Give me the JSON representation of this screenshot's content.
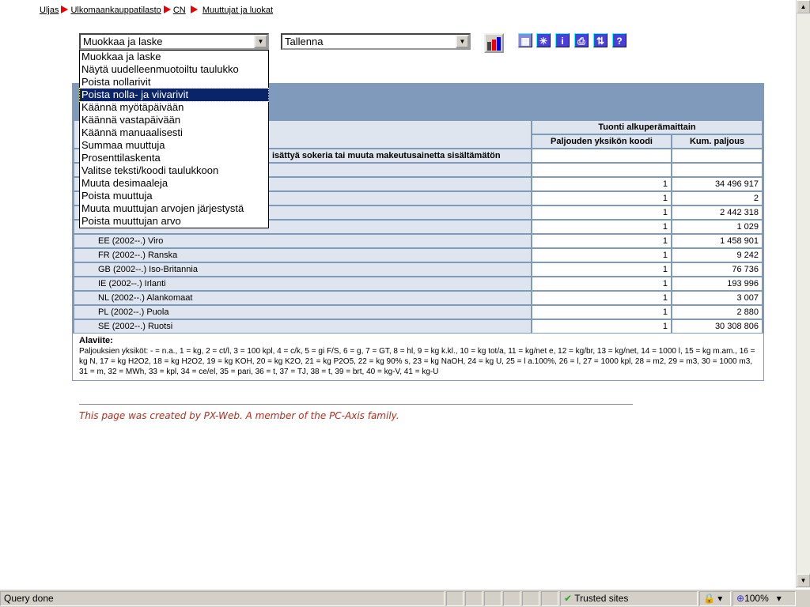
{
  "breadcrumb": [
    "Uljas",
    "Ulkomaankauppatilasto",
    "CN",
    "Muuttujat ja luokat"
  ],
  "toolbar": {
    "action_select": "Muokkaa ja laske",
    "save_select": "Tallenna",
    "options": [
      "Muokkaa ja laske",
      "Näytä uudelleenmuotoiltu taulukko",
      "Poista nollarivit",
      "Poista nolla- ja viivarivit",
      "Käännä myötäpäivään",
      "Käännä vastapäivään",
      "Käännä manuaalisesti",
      "Summaa muuttuja",
      "Prosenttilaskenta",
      "Valitse teksti/koodi taulukkoon",
      "Muuta desimaaleja",
      "Poista muuttuja",
      "Muuta muuttujan arvojen järjestystä",
      "Poista muuttujan arvo"
    ],
    "highlighted": "Poista nolla- ja viivarivit",
    "icons": [
      "chart-icon",
      "table-icon",
      "asterisk-icon",
      "info-icon",
      "print-icon",
      "sort-icon",
      "help-icon"
    ]
  },
  "table": {
    "group_header": "Tuonti alkuperämaittain",
    "columns": [
      "Paljouden yksikön koodi",
      "Kum. paljous"
    ],
    "product_row": "isättyä sokeria tai muuta makeutusainetta sisältämätön",
    "rows": [
      {
        "label": "",
        "code": "1",
        "value": "34 496 917"
      },
      {
        "label": "",
        "code": "1",
        "value": "2"
      },
      {
        "label": "",
        "code": "1",
        "value": "2 442 318"
      },
      {
        "label": "",
        "code": "1",
        "value": "1 029"
      },
      {
        "label": "EE (2002--.) Viro",
        "code": "1",
        "value": "1 458 901"
      },
      {
        "label": "FR (2002--.) Ranska",
        "code": "1",
        "value": "9 242"
      },
      {
        "label": "GB (2002--.) Iso-Britannia",
        "code": "1",
        "value": "76 736"
      },
      {
        "label": "IE (2002--.) Irlanti",
        "code": "1",
        "value": "193 996"
      },
      {
        "label": "NL (2002--.) Alankomaat",
        "code": "1",
        "value": "3 007"
      },
      {
        "label": "PL (2002--.) Puola",
        "code": "1",
        "value": "2 880"
      },
      {
        "label": "SE (2002--.) Ruotsi",
        "code": "1",
        "value": "30 308 806"
      }
    ],
    "footnote_title": "Alaviite:",
    "footnote": "Paljouksien yksiköt: - = n.a., 1 = kg, 2 = ct/l, 3 = 100 kpl, 4 = c/k, 5 = gi F/S, 6 = g, 7 = GT, 8 = hl, 9 = kg k.kl., 10 = kg tot/a, 11 = kg/net e, 12 = kg/br, 13 = kg/net, 14 = 1000 l, 15 = kg m.am., 16 = kg N, 17 = kg H2O2, 18 = kg H2O2, 19 = kg KOH, 20 = kg K2O, 21 = kg P2O5, 22 = kg 90% s, 23 = kg NaOH, 24 = kg U, 25 = l a.100%, 26 = l, 27 = 1000 kpl, 28 = m2, 29 = m3, 30 = 1000 m3, 31 = m, 32 = MWh, 33 = kpl, 34 = ce/el, 35 = pari, 36 = t, 37 = TJ, 38 = t, 39 = brt, 40 = kg-V, 41 = kg-U"
  },
  "credit": "This page was created by PX-Web. A member of the PC-Axis family.",
  "status": {
    "text": "Query done",
    "zone": "Trusted sites",
    "zoom": "100%"
  }
}
